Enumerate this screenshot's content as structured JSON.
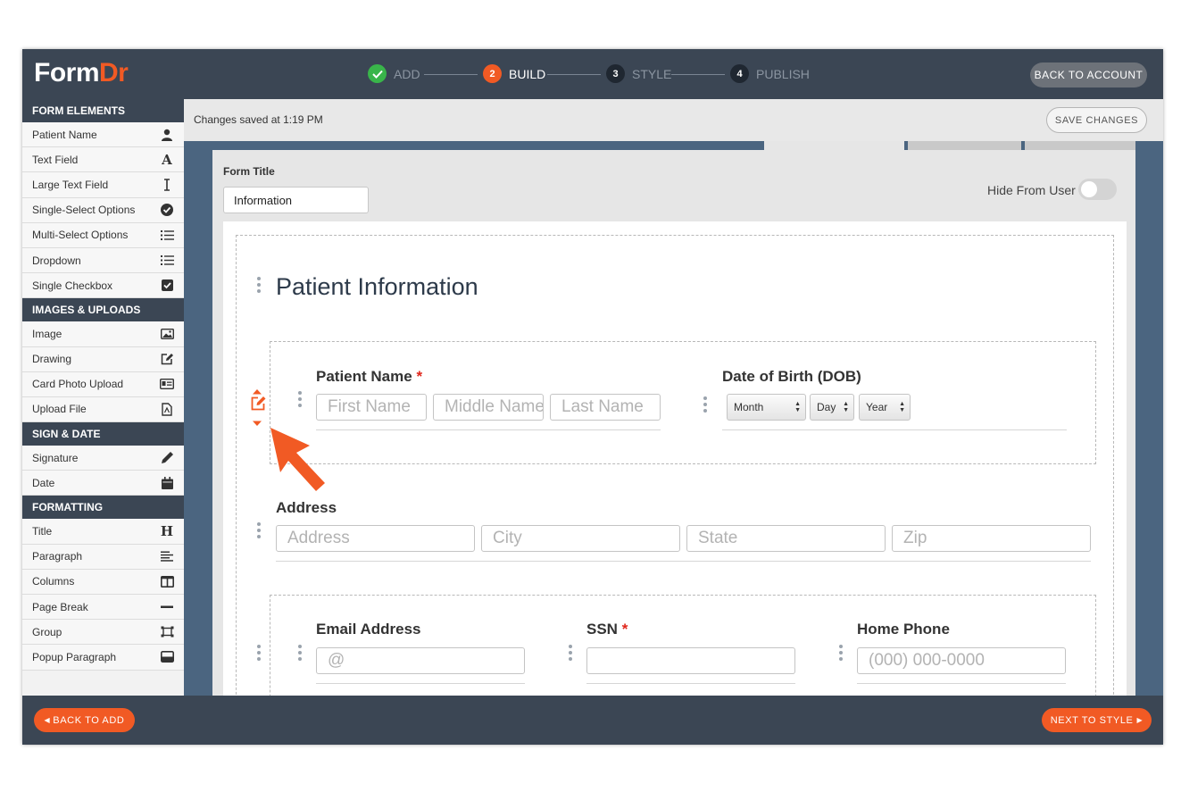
{
  "app": {
    "logo": {
      "main": "Form",
      "accent": "Dr"
    },
    "accent_color": "#f15a24",
    "header_color": "#3b4654"
  },
  "steps": [
    {
      "number": "✓",
      "label": "ADD",
      "state": "done",
      "color": "#39b54a"
    },
    {
      "number": "2",
      "label": "BUILD",
      "state": "active",
      "color": "#f15a24"
    },
    {
      "number": "3",
      "label": "STYLE",
      "state": "pending",
      "color": "#1f2731"
    },
    {
      "number": "4",
      "label": "PUBLISH",
      "state": "pending",
      "color": "#1f2731"
    }
  ],
  "header": {
    "back_to_account": "BACK TO ACCOUNT"
  },
  "sidebar": {
    "sections": [
      {
        "title": "FORM ELEMENTS",
        "items": [
          {
            "label": "Patient Name",
            "icon": "person-icon"
          },
          {
            "label": "Text Field",
            "icon": "letter-a-icon"
          },
          {
            "label": "Large Text Field",
            "icon": "text-cursor-icon"
          },
          {
            "label": "Single-Select Options",
            "icon": "check-circle-icon"
          },
          {
            "label": "Multi-Select Options",
            "icon": "list-icon"
          },
          {
            "label": "Dropdown",
            "icon": "list-icon"
          },
          {
            "label": "Single Checkbox",
            "icon": "checkbox-icon"
          }
        ]
      },
      {
        "title": "IMAGES & UPLOADS",
        "items": [
          {
            "label": "Image",
            "icon": "image-icon"
          },
          {
            "label": "Drawing",
            "icon": "pencil-square-icon"
          },
          {
            "label": "Card Photo Upload",
            "icon": "id-card-icon"
          },
          {
            "label": "Upload File",
            "icon": "file-icon"
          }
        ]
      },
      {
        "title": "SIGN & DATE",
        "items": [
          {
            "label": "Signature",
            "icon": "pen-icon"
          },
          {
            "label": "Date",
            "icon": "calendar-icon"
          }
        ]
      },
      {
        "title": "FORMATTING",
        "items": [
          {
            "label": "Title",
            "icon": "heading-icon"
          },
          {
            "label": "Paragraph",
            "icon": "align-left-icon"
          },
          {
            "label": "Columns",
            "icon": "columns-icon"
          },
          {
            "label": "Page Break",
            "icon": "minus-icon"
          },
          {
            "label": "Group",
            "icon": "group-icon"
          },
          {
            "label": "Popup Paragraph",
            "icon": "window-icon"
          }
        ]
      }
    ]
  },
  "savebar": {
    "status": "Changes saved at 1:19 PM",
    "save_label": "SAVE CHANGES"
  },
  "form": {
    "title_label": "Form Title",
    "title_value": "Information",
    "hide_from_user_label": "Hide From User",
    "hide_from_user_on": false,
    "heading": "Patient Information",
    "patient_name": {
      "label": "Patient Name",
      "required_mark": "*",
      "first_placeholder": "First Name",
      "middle_placeholder": "Middle Name",
      "last_placeholder": "Last Name"
    },
    "dob": {
      "label": "Date of Birth (DOB)",
      "month": "Month",
      "day": "Day",
      "year": "Year"
    },
    "address": {
      "label": "Address",
      "address_placeholder": "Address",
      "city_placeholder": "City",
      "state_placeholder": "State",
      "zip_placeholder": "Zip"
    },
    "email": {
      "label": "Email Address",
      "placeholder": "@"
    },
    "ssn": {
      "label": "SSN",
      "required_mark": "*",
      "placeholder": ""
    },
    "home_phone": {
      "label": "Home Phone",
      "placeholder": "(000) 000-0000"
    }
  },
  "footer": {
    "back_label": "BACK TO ADD",
    "next_label": "NEXT TO STYLE"
  }
}
